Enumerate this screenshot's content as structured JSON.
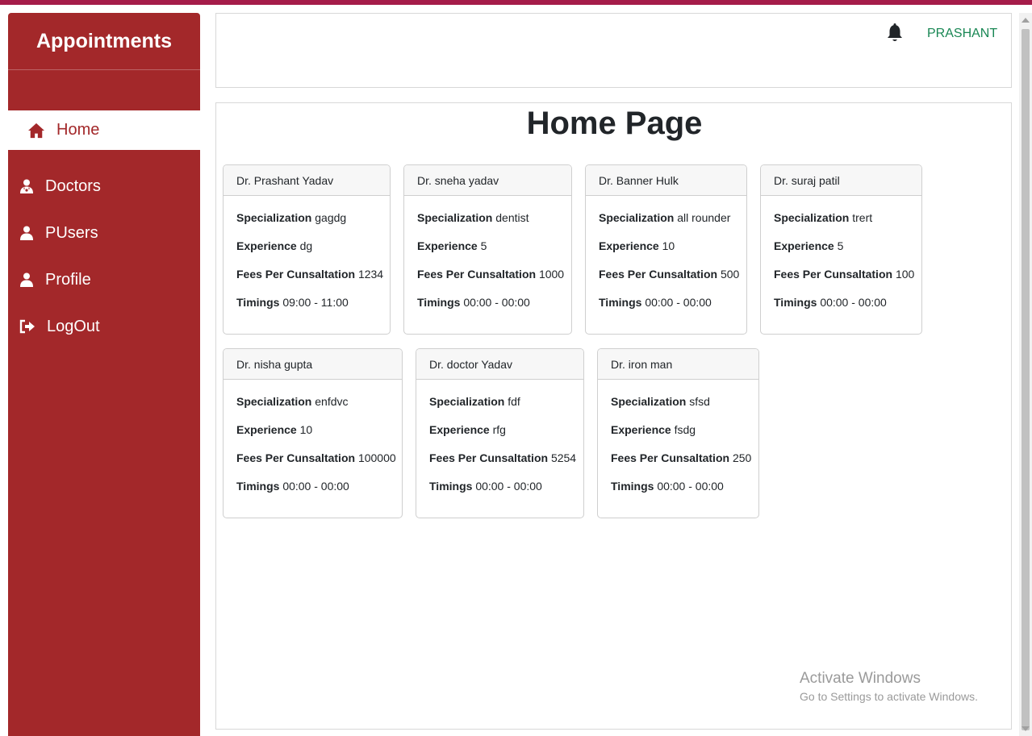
{
  "app": {
    "title": "Appointments"
  },
  "sidebar": {
    "items": [
      {
        "label": "Home",
        "icon": "home-icon",
        "active": true
      },
      {
        "label": "Doctors",
        "icon": "doctor-icon",
        "active": false
      },
      {
        "label": "PUsers",
        "icon": "user-icon",
        "active": false
      },
      {
        "label": "Profile",
        "icon": "user-icon",
        "active": false
      },
      {
        "label": "LogOut",
        "icon": "logout-icon",
        "active": false
      }
    ]
  },
  "header": {
    "notification_icon": "bell-icon",
    "username": "PRASHANT"
  },
  "main": {
    "title": "Home Page",
    "field_labels": {
      "specialization": "Specialization",
      "experience": "Experience",
      "fees": "Fees Per Cunsaltation",
      "timings": "Timings"
    },
    "doctors": [
      {
        "name": "Dr. Prashant Yadav",
        "specialization": "gagdg",
        "experience": "dg",
        "fees": "1234",
        "timings": "09:00 - 11:00"
      },
      {
        "name": "Dr. sneha yadav",
        "specialization": "dentist",
        "experience": "5",
        "fees": "1000",
        "timings": "00:00 - 00:00"
      },
      {
        "name": "Dr. Banner Hulk",
        "specialization": "all rounder",
        "experience": "10",
        "fees": "500",
        "timings": "00:00 - 00:00"
      },
      {
        "name": "Dr. suraj patil",
        "specialization": "trert",
        "experience": "5",
        "fees": "100",
        "timings": "00:00 - 00:00"
      },
      {
        "name": "Dr. nisha gupta",
        "specialization": "enfdvc",
        "experience": "10",
        "fees": "100000",
        "timings": "00:00 - 00:00"
      },
      {
        "name": "Dr. doctor Yadav",
        "specialization": "fdf",
        "experience": "rfg",
        "fees": "5254",
        "timings": "00:00 - 00:00"
      },
      {
        "name": "Dr. iron man",
        "specialization": "sfsd",
        "experience": "fsdg",
        "fees": "250",
        "timings": "00:00 - 00:00"
      }
    ]
  },
  "watermark": {
    "title": "Activate Windows",
    "subtitle": "Go to Settings to activate Windows."
  },
  "colors": {
    "sidebar": "#a3282a",
    "username": "#198754",
    "top_strip": "#a51c4a"
  }
}
